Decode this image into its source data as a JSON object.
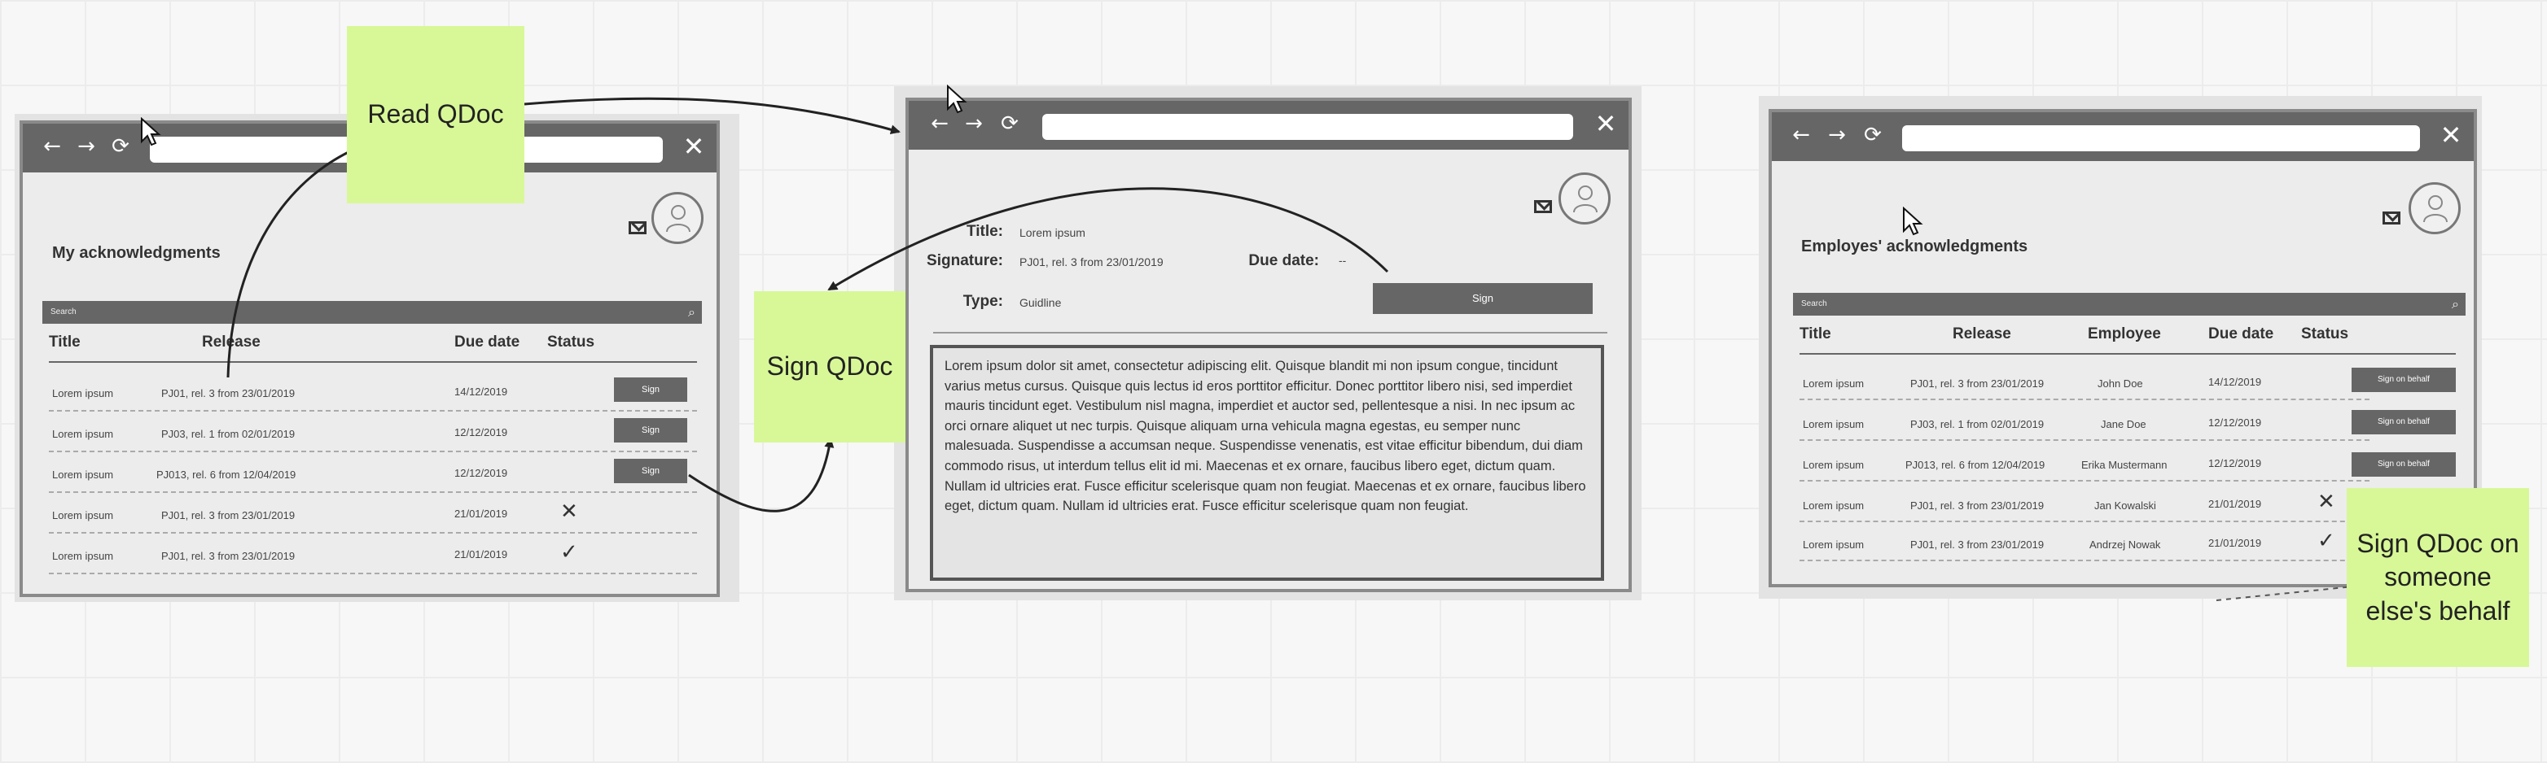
{
  "accent": "#d8f898",
  "screen1": {
    "nav": {
      "back_icon": "←",
      "forward_icon": "→",
      "reload_icon": "⟳",
      "close_icon": "✕"
    },
    "title": "My acknowledgments",
    "search_placeholder": "Search",
    "columns": [
      "Title",
      "Release",
      "Due date",
      "Status"
    ],
    "rows": [
      {
        "title": "Lorem ipsum",
        "release": "PJ01, rel. 3 from 23/01/2019",
        "due": "14/12/2019",
        "status": "Sign"
      },
      {
        "title": "Lorem ipsum",
        "release": "PJ03, rel. 1 from 02/01/2019",
        "due": "12/12/2019",
        "status": "Sign"
      },
      {
        "title": "Lorem ipsum",
        "release": "PJ013, rel. 6 from 12/04/2019",
        "due": "12/12/2019",
        "status": "Sign"
      },
      {
        "title": "Lorem ipsum",
        "release": "PJ01, rel. 3 from 23/01/2019",
        "due": "21/01/2019",
        "status": "✕"
      },
      {
        "title": "Lorem ipsum",
        "release": "PJ01, rel. 3 from 23/01/2019",
        "due": "21/01/2019",
        "status": "✓"
      }
    ]
  },
  "screen2": {
    "fields": {
      "title_label": "Title:",
      "title_value": "Lorem ipsum",
      "signature_label": "Signature:",
      "signature_value": "PJ01, rel. 3 from 23/01/2019",
      "due_label": "Due date:",
      "due_value": "--",
      "type_label": "Type:",
      "type_value": "Guidline"
    },
    "sign_button": "Sign",
    "body_text": "Lorem ipsum dolor sit amet, consectetur adipiscing elit. Quisque blandit mi non ipsum congue, tincidunt varius metus cursus. Quisque quis lectus id eros porttitor efficitur. Donec porttitor libero nisi, sed imperdiet mauris tincidunt eget. Vestibulum nisl magna, imperdiet et auctor sed, pellentesque a nisi. In nec ipsum ac orci ornare aliquet ut nec turpis. Quisque aliquam urna vehicula magna egestas, eu semper nunc malesuada. Suspendisse a accumsan neque. Suspendisse venenatis, est vitae efficitur bibendum, dui diam commodo risus, ut interdum tellus elit id mi. Maecenas et ex ornare, faucibus libero eget, dictum quam. Nullam id ultricies erat. Fusce efficitur scelerisque quam non feugiat. Maecenas et ex ornare, faucibus libero eget, dictum quam. Nullam id ultricies erat. Fusce efficitur scelerisque quam non feugiat."
  },
  "screen3": {
    "title": "Employes' acknowledgments",
    "search_placeholder": "Search",
    "columns": [
      "Title",
      "Release",
      "Employee",
      "Due date",
      "Status"
    ],
    "rows": [
      {
        "title": "Lorem ipsum",
        "release": "PJ01, rel. 3 from 23/01/2019",
        "employee": "John Doe",
        "due": "14/12/2019",
        "status": "Sign on behalf"
      },
      {
        "title": "Lorem ipsum",
        "release": "PJ03, rel. 1 from 02/01/2019",
        "employee": "Jane Doe",
        "due": "12/12/2019",
        "status": "Sign on behalf"
      },
      {
        "title": "Lorem ipsum",
        "release": "PJ013, rel. 6 from 12/04/2019",
        "employee": "Erika Mustermann",
        "due": "12/12/2019",
        "status": "Sign on behalf"
      },
      {
        "title": "Lorem ipsum",
        "release": "PJ01, rel. 3 from 23/01/2019",
        "employee": "Jan Kowalski",
        "due": "21/01/2019",
        "status": "✕"
      },
      {
        "title": "Lorem ipsum",
        "release": "PJ01, rel. 3 from 23/01/2019",
        "employee": "Andrzej Nowak",
        "due": "21/01/2019",
        "status": "✓"
      }
    ]
  },
  "notes": {
    "read": "Read QDoc",
    "sign": "Sign QDoc",
    "behalf": "Sign QDoc on someone else's behalf"
  }
}
